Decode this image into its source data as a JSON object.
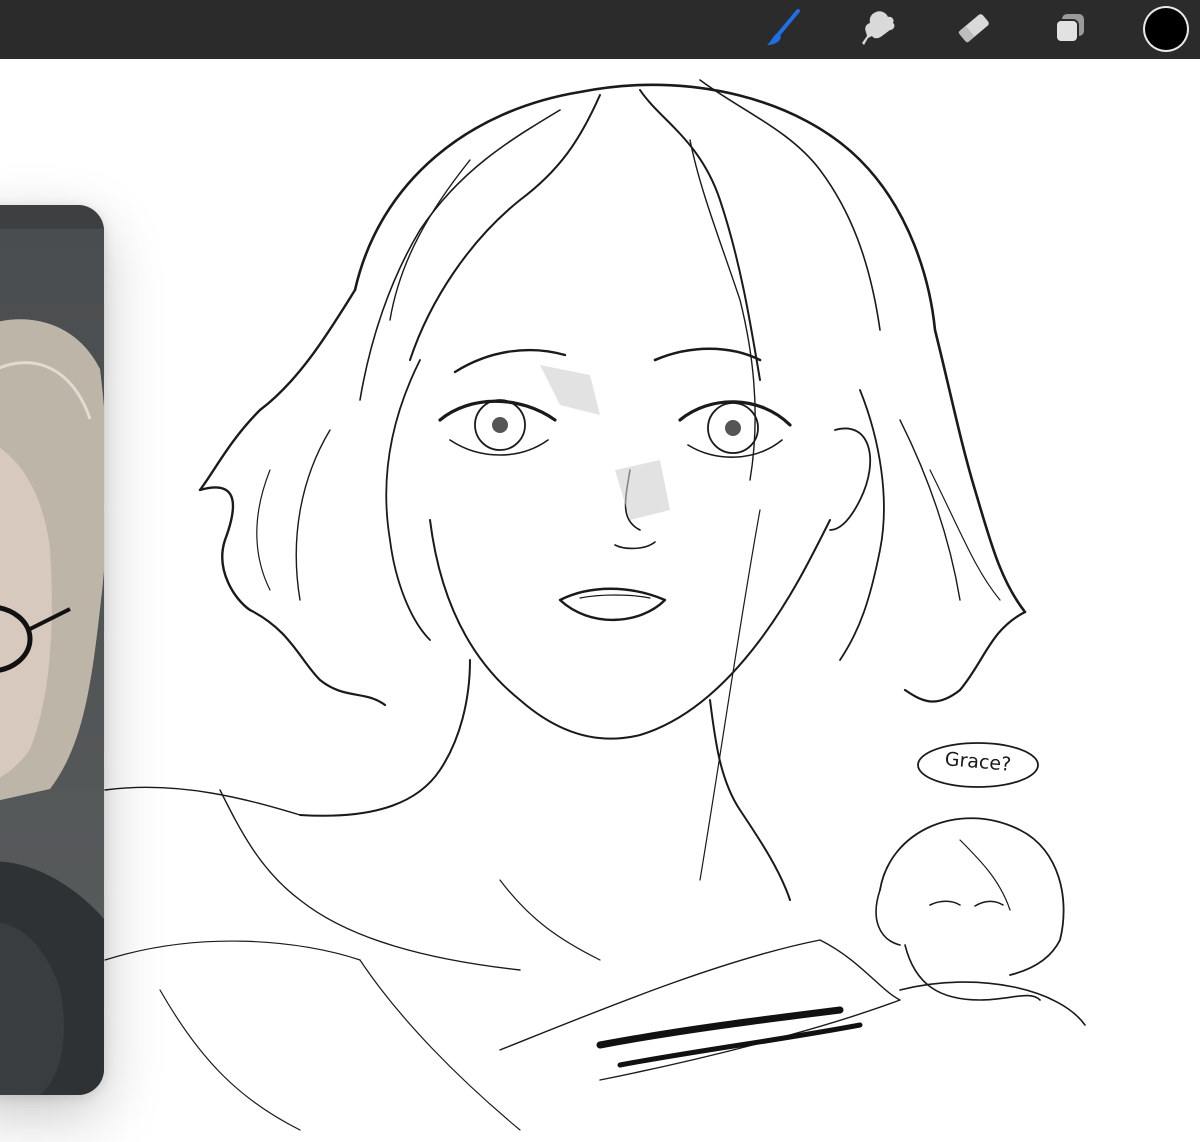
{
  "toolbar": {
    "tools": [
      {
        "name": "brush",
        "icon": "paintbrush-icon",
        "active": true
      },
      {
        "name": "smudge",
        "icon": "smudge-icon",
        "active": false
      },
      {
        "name": "eraser",
        "icon": "eraser-icon",
        "active": false
      },
      {
        "name": "layers",
        "icon": "layers-icon",
        "active": false
      }
    ],
    "current_color": "#000000",
    "active_color": "#1e6fe6"
  },
  "reference_window": {
    "content": "portrait-photo"
  },
  "canvas": {
    "speech_bubble_text": "Grace?"
  }
}
